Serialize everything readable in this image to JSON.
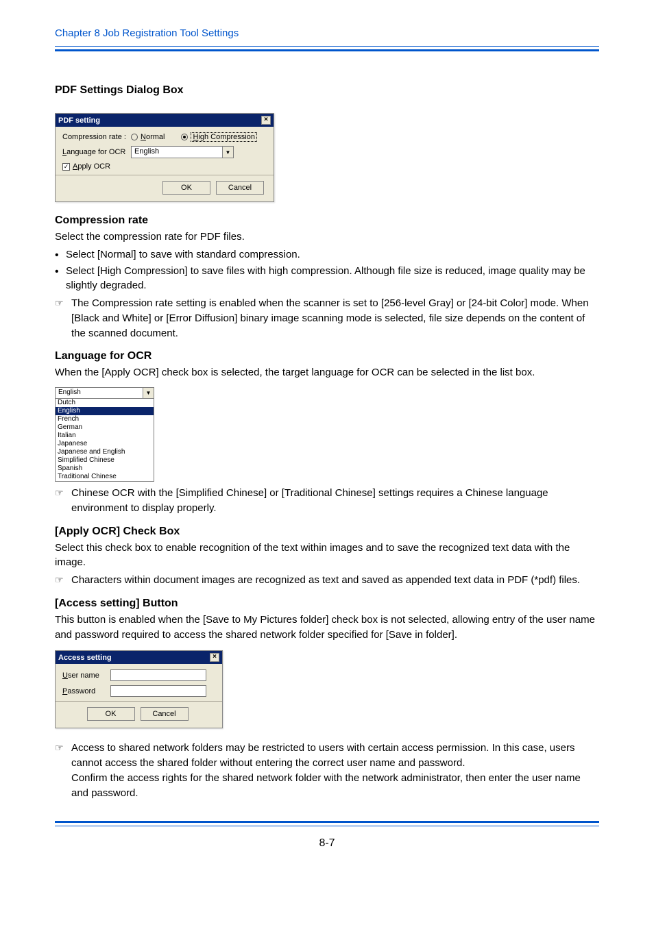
{
  "header": {
    "chapter": "Chapter 8   Job Registration Tool Settings"
  },
  "page_number": "8-7",
  "title": "PDF Settings Dialog Box",
  "pdf_dialog": {
    "title": "PDF setting",
    "compression_label": "Compression rate :",
    "radio_normal": "Normal",
    "radio_high": "High Compression",
    "language_label": "Language for OCR",
    "language_value": "English",
    "apply_ocr": "Apply OCR",
    "ok": "OK",
    "cancel": "Cancel"
  },
  "compression": {
    "heading": "Compression rate",
    "intro": "Select the compression rate for PDF files.",
    "bullet1": "Select [Normal] to save with standard compression.",
    "bullet2": "Select [High Compression] to save files with high compression. Although file size is reduced, image quality may be slightly degraded.",
    "note": "The Compression rate setting is enabled when the scanner is set to [256-level Gray] or [24-bit Color] mode. When [Black and White] or [Error Diffusion] binary image scanning mode is selected, file size depends on the content of the scanned document."
  },
  "language": {
    "heading": "Language for OCR",
    "intro": "When the [Apply OCR] check box is selected, the target language for OCR can be selected in the list box.",
    "combo_value": "English",
    "options": [
      "Dutch",
      "English",
      "French",
      "German",
      "Italian",
      "Japanese",
      "Japanese and English",
      "Simplified Chinese",
      "Spanish",
      "Traditional Chinese"
    ],
    "selected_index": 1,
    "note": "Chinese OCR with the [Simplified Chinese] or [Traditional Chinese] settings requires a Chinese language environment to display properly."
  },
  "apply_ocr": {
    "heading": "[Apply OCR] Check Box",
    "intro": "Select this check box to enable recognition of the text within images and to save the recognized text data with the image.",
    "note": "Characters within document images are recognized as text and saved as appended text data in PDF (*pdf) files."
  },
  "access": {
    "heading": "[Access setting] Button",
    "intro": "This button is enabled when the [Save to My Pictures folder] check box is not selected, allowing entry of the user name and password required to access the shared network folder specified for [Save in folder].",
    "dialog": {
      "title": "Access setting",
      "user_label": "User name",
      "password_label": "Password",
      "ok": "OK",
      "cancel": "Cancel"
    },
    "note1": "Access to shared network folders may be restricted to users with certain access permission. In this case, users cannot access the shared folder without entering the correct user name and password.",
    "note2": "Confirm the access rights for the shared network folder with the network administrator, then enter the user name and password."
  }
}
